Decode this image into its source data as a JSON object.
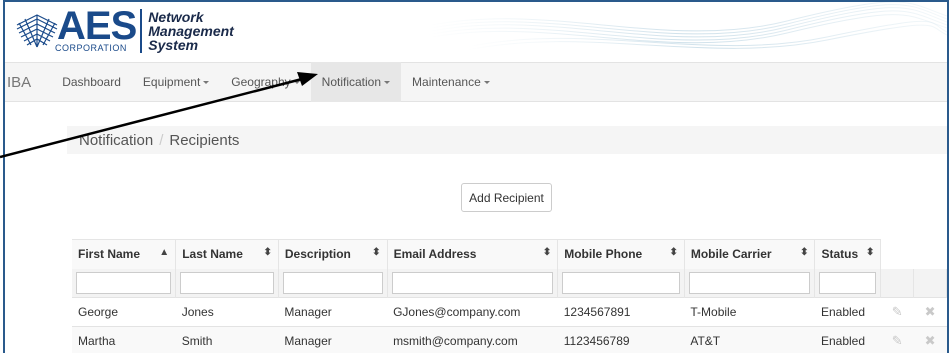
{
  "brand": {
    "logo_text": "AES",
    "corp_text": "CORPORATION",
    "system_lines": [
      "Network",
      "Management",
      "System"
    ]
  },
  "nav": {
    "brand": "IBA",
    "items": [
      {
        "label": "Dashboard",
        "dropdown": false
      },
      {
        "label": "Equipment",
        "dropdown": true
      },
      {
        "label": "Geography",
        "dropdown": true
      },
      {
        "label": "Notification",
        "dropdown": true,
        "active": true
      },
      {
        "label": "Maintenance",
        "dropdown": true
      }
    ]
  },
  "breadcrumb": {
    "parent": "Notification",
    "separator": "/",
    "current": "Recipients"
  },
  "add_button": "Add Recipient",
  "table": {
    "columns": [
      {
        "label": "First Name",
        "sort": "▲"
      },
      {
        "label": "Last Name",
        "sort": "⬍"
      },
      {
        "label": "Description",
        "sort": "⬍"
      },
      {
        "label": "Email Address",
        "sort": "⬍"
      },
      {
        "label": "Mobile Phone",
        "sort": "⬍"
      },
      {
        "label": "Mobile Carrier",
        "sort": "⬍"
      },
      {
        "label": "Status",
        "sort": "⬍"
      }
    ],
    "rows": [
      {
        "first": "George",
        "last": "Jones",
        "desc": "Manager",
        "email": "GJones@company.com",
        "phone": "1234567891",
        "carrier": "T-Mobile",
        "status": "Enabled"
      },
      {
        "first": "Martha",
        "last": "Smith",
        "desc": "Manager",
        "email": "msmith@company.com",
        "phone": "1123456789",
        "carrier": "AT&T",
        "status": "Enabled"
      }
    ],
    "edit_icon": "pencil-icon",
    "delete_icon": "x-icon"
  },
  "colors": {
    "frame": "#2a5a8c",
    "logo": "#1a4a8a",
    "navbar": "#f5f5f5"
  }
}
